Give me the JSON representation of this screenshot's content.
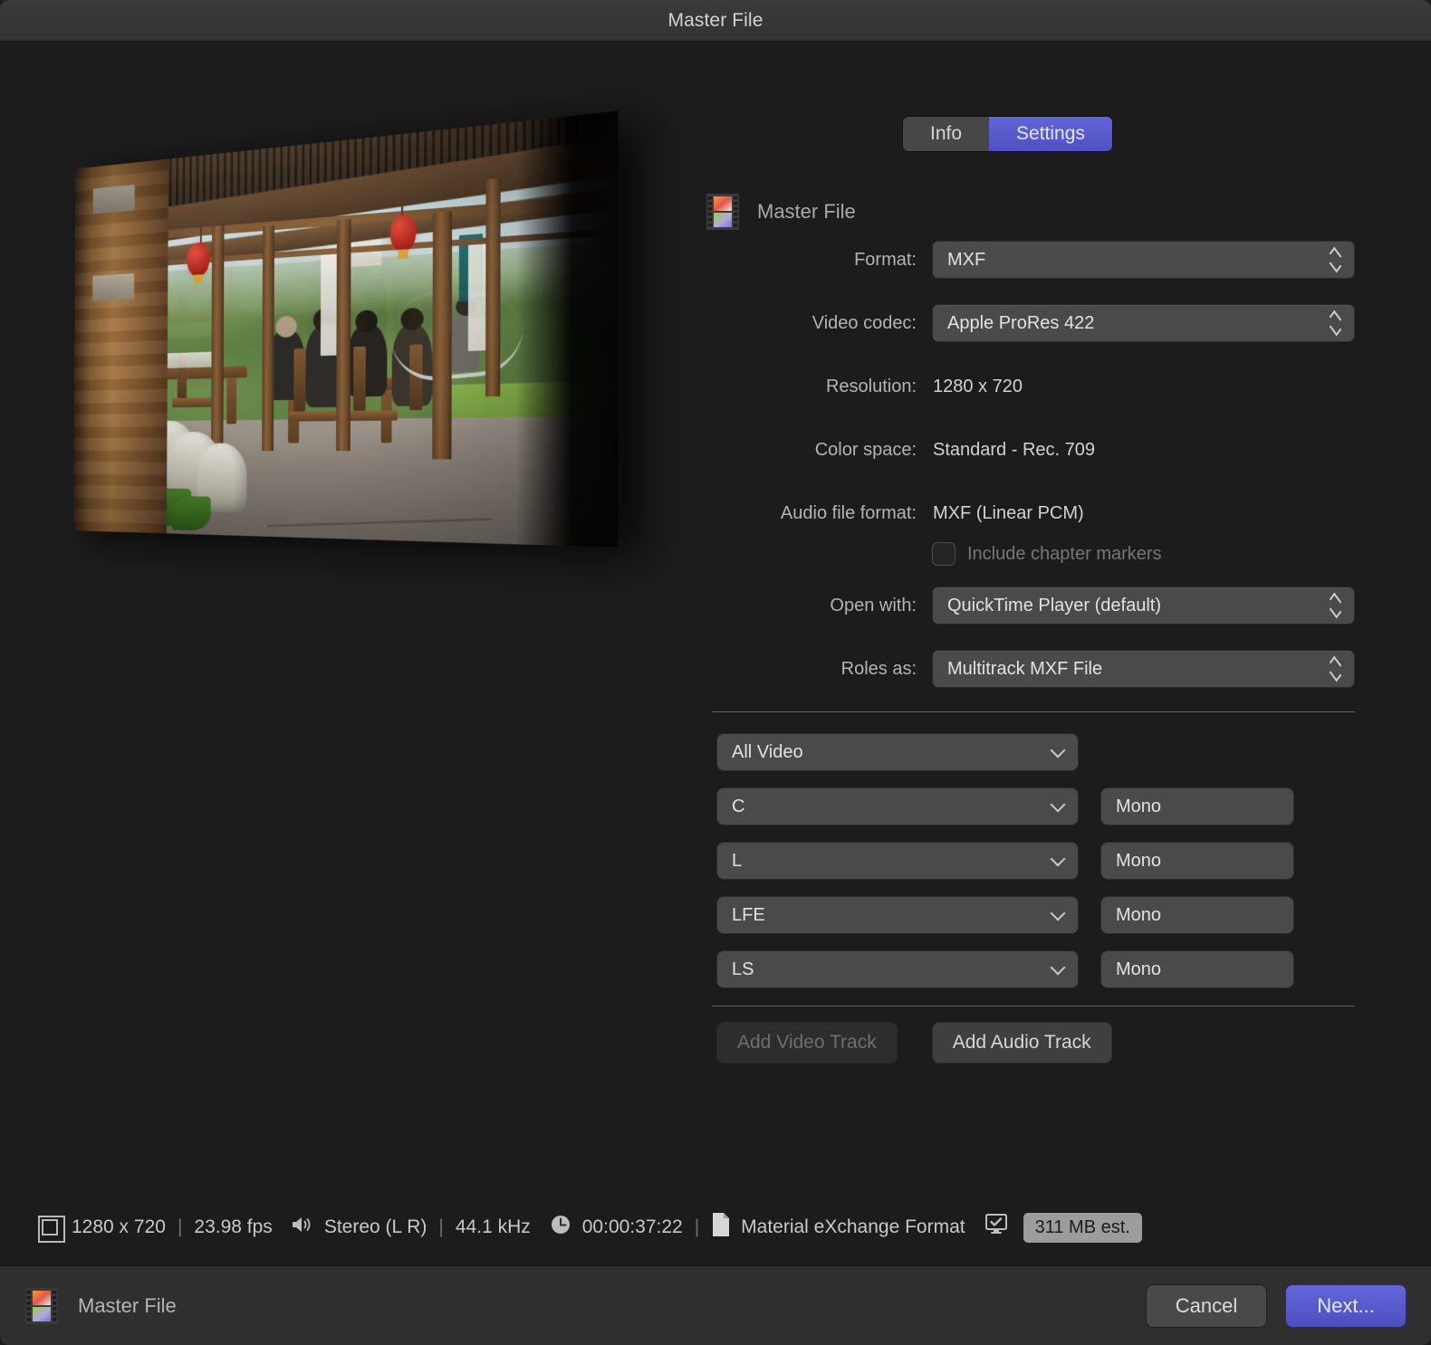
{
  "window": {
    "title": "Master File"
  },
  "tabs": {
    "info_label": "Info",
    "settings_label": "Settings",
    "selected": "Settings"
  },
  "pane": {
    "icon": "film-strip-icon",
    "title": "Master File",
    "fields": [
      {
        "label": "Format:",
        "value": "MXF",
        "control": "popup"
      },
      {
        "label": "Video codec:",
        "value": "Apple ProRes 422",
        "control": "popup"
      },
      {
        "label": "Resolution:",
        "value": "1280 x 720",
        "control": "static"
      },
      {
        "label": "Color space:",
        "value": "Standard - Rec. 709",
        "control": "static"
      },
      {
        "label": "Audio file format:",
        "value": "MXF (Linear PCM)",
        "control": "static"
      }
    ],
    "chapter_markers": {
      "label": "Include chapter markers",
      "checked": false,
      "enabled": false
    },
    "open_with": {
      "label": "Open with:",
      "value": "QuickTime Player (default)"
    },
    "roles_as": {
      "label": "Roles as:",
      "value": "Multitrack MXF File"
    }
  },
  "tracks": {
    "video": [
      {
        "role": "All Video"
      }
    ],
    "audio": [
      {
        "role": "C",
        "channels": "Mono"
      },
      {
        "role": "L",
        "channels": "Mono"
      },
      {
        "role": "LFE",
        "channels": "Mono"
      },
      {
        "role": "LS",
        "channels": "Mono"
      }
    ],
    "add_video_label": "Add Video Track",
    "add_video_enabled": false,
    "add_audio_label": "Add Audio Track",
    "add_audio_enabled": true
  },
  "status": {
    "resolution": "1280 x 720",
    "fps": "23.98 fps",
    "audio_channels": "Stereo (L R)",
    "sample_rate": "44.1 kHz",
    "duration": "00:00:37:22",
    "file_format": "Material eXchange Format",
    "size_estimate": "311 MB est.",
    "separator": "|"
  },
  "bottom": {
    "icon": "film-strip-icon",
    "title": "Master File",
    "cancel_label": "Cancel",
    "next_label": "Next..."
  },
  "colors": {
    "accent": "#5b5fd0",
    "window_bg": "#1c1c1c",
    "titlebar_bg": "#353535",
    "control_bg": "#4a4a4a",
    "pill_bg": "#9c9c9c"
  },
  "preview": {
    "description": "Perspective preview of a wooden pavilion restaurant with red lanterns, diners at tables, and a green mountain valley view"
  }
}
